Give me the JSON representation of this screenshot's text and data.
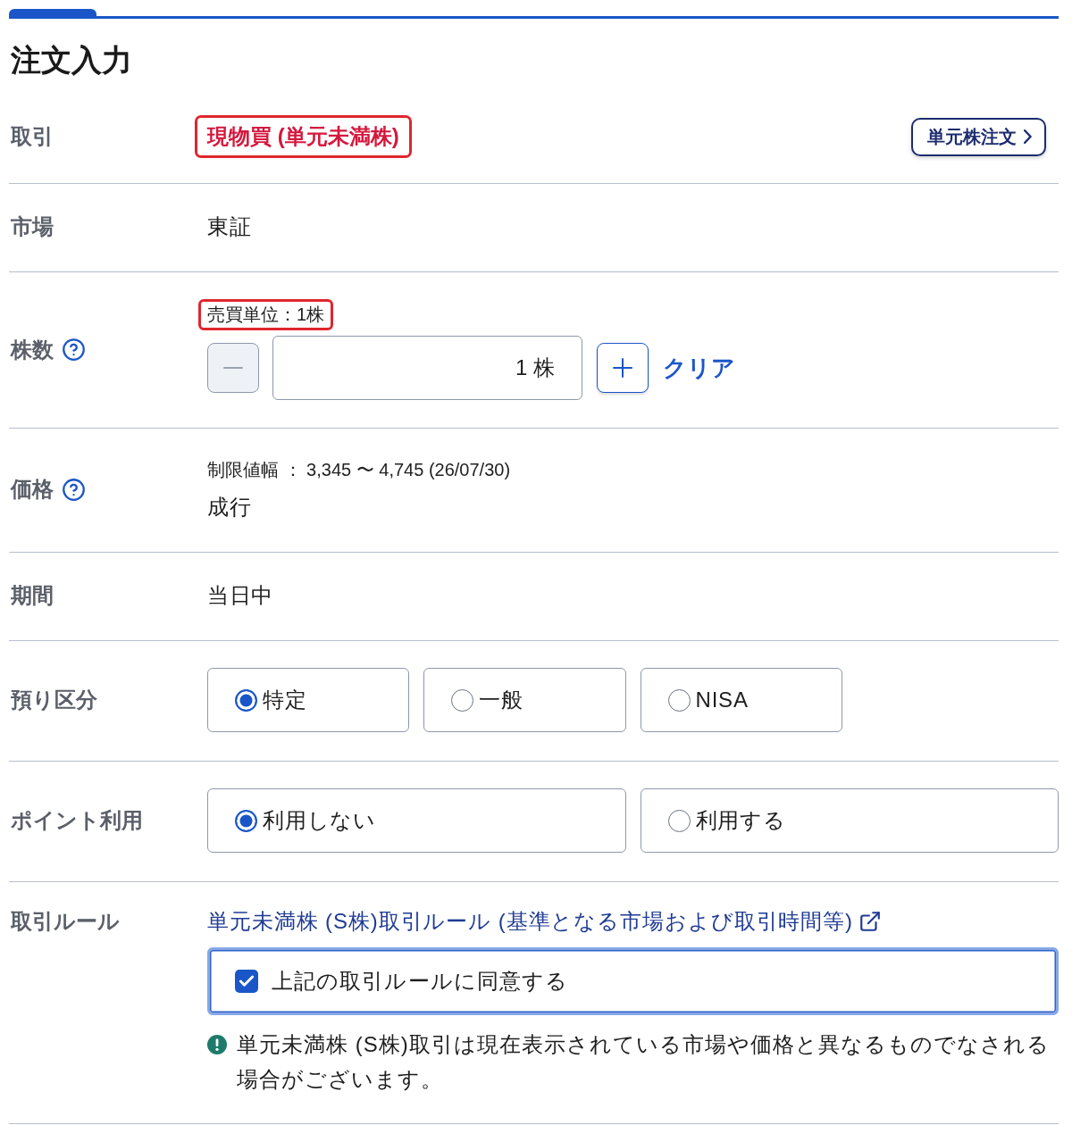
{
  "header": {
    "title": "注文入力"
  },
  "rows": [
    {
      "kind": "trade",
      "label": "取引",
      "help": false,
      "value": "現物買 (単元未満株)",
      "highlighted": true,
      "button": "単元株注文"
    },
    {
      "kind": "text",
      "label": "市場",
      "help": false,
      "value": "東証"
    },
    {
      "kind": "quantity",
      "label": "株数",
      "help": true,
      "unit_note": "売買単位：1株",
      "note_highlighted": true,
      "minus_disabled": true,
      "value": "1 株",
      "clear_link": "クリア"
    },
    {
      "kind": "price",
      "label": "価格",
      "help": true,
      "range": "制限値幅 ： 3,345 〜 4,745 (26/07/30)",
      "value": "成行"
    },
    {
      "kind": "text",
      "label": "期間",
      "help": false,
      "value": "当日中"
    },
    {
      "kind": "options",
      "label": "預り区分",
      "help": false,
      "options": [
        {
          "label": "特定",
          "selected": true
        },
        {
          "label": "一般",
          "selected": false
        },
        {
          "label": "NISA",
          "selected": false
        }
      ]
    },
    {
      "kind": "options",
      "label": "ポイント利用",
      "help": false,
      "options": [
        {
          "label": "利用しない",
          "selected": true
        },
        {
          "label": "利用する",
          "selected": false
        }
      ]
    },
    {
      "kind": "rules",
      "label": "取引ルール",
      "help": false,
      "link": "単元未満株 (S株)取引ルール (基準となる市場および取引時間等)",
      "agreement": {
        "label": "上記の取引ルールに同意する",
        "checked": true,
        "focused": true
      },
      "notice": "単元未満株 (S株)取引は現在表示されている市場や価格と異なるものでなされる場合がございます。"
    }
  ]
}
